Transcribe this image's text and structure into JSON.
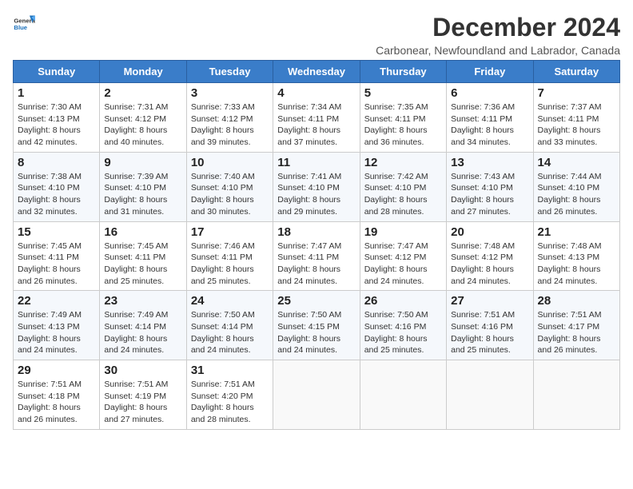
{
  "logo": {
    "line1": "General",
    "line2": "Blue"
  },
  "title": "December 2024",
  "subtitle": "Carbonear, Newfoundland and Labrador, Canada",
  "days_of_week": [
    "Sunday",
    "Monday",
    "Tuesday",
    "Wednesday",
    "Thursday",
    "Friday",
    "Saturday"
  ],
  "weeks": [
    [
      {
        "day": "1",
        "info": "Sunrise: 7:30 AM\nSunset: 4:13 PM\nDaylight: 8 hours\nand 42 minutes."
      },
      {
        "day": "2",
        "info": "Sunrise: 7:31 AM\nSunset: 4:12 PM\nDaylight: 8 hours\nand 40 minutes."
      },
      {
        "day": "3",
        "info": "Sunrise: 7:33 AM\nSunset: 4:12 PM\nDaylight: 8 hours\nand 39 minutes."
      },
      {
        "day": "4",
        "info": "Sunrise: 7:34 AM\nSunset: 4:11 PM\nDaylight: 8 hours\nand 37 minutes."
      },
      {
        "day": "5",
        "info": "Sunrise: 7:35 AM\nSunset: 4:11 PM\nDaylight: 8 hours\nand 36 minutes."
      },
      {
        "day": "6",
        "info": "Sunrise: 7:36 AM\nSunset: 4:11 PM\nDaylight: 8 hours\nand 34 minutes."
      },
      {
        "day": "7",
        "info": "Sunrise: 7:37 AM\nSunset: 4:11 PM\nDaylight: 8 hours\nand 33 minutes."
      }
    ],
    [
      {
        "day": "8",
        "info": "Sunrise: 7:38 AM\nSunset: 4:10 PM\nDaylight: 8 hours\nand 32 minutes."
      },
      {
        "day": "9",
        "info": "Sunrise: 7:39 AM\nSunset: 4:10 PM\nDaylight: 8 hours\nand 31 minutes."
      },
      {
        "day": "10",
        "info": "Sunrise: 7:40 AM\nSunset: 4:10 PM\nDaylight: 8 hours\nand 30 minutes."
      },
      {
        "day": "11",
        "info": "Sunrise: 7:41 AM\nSunset: 4:10 PM\nDaylight: 8 hours\nand 29 minutes."
      },
      {
        "day": "12",
        "info": "Sunrise: 7:42 AM\nSunset: 4:10 PM\nDaylight: 8 hours\nand 28 minutes."
      },
      {
        "day": "13",
        "info": "Sunrise: 7:43 AM\nSunset: 4:10 PM\nDaylight: 8 hours\nand 27 minutes."
      },
      {
        "day": "14",
        "info": "Sunrise: 7:44 AM\nSunset: 4:10 PM\nDaylight: 8 hours\nand 26 minutes."
      }
    ],
    [
      {
        "day": "15",
        "info": "Sunrise: 7:45 AM\nSunset: 4:11 PM\nDaylight: 8 hours\nand 26 minutes."
      },
      {
        "day": "16",
        "info": "Sunrise: 7:45 AM\nSunset: 4:11 PM\nDaylight: 8 hours\nand 25 minutes."
      },
      {
        "day": "17",
        "info": "Sunrise: 7:46 AM\nSunset: 4:11 PM\nDaylight: 8 hours\nand 25 minutes."
      },
      {
        "day": "18",
        "info": "Sunrise: 7:47 AM\nSunset: 4:11 PM\nDaylight: 8 hours\nand 24 minutes."
      },
      {
        "day": "19",
        "info": "Sunrise: 7:47 AM\nSunset: 4:12 PM\nDaylight: 8 hours\nand 24 minutes."
      },
      {
        "day": "20",
        "info": "Sunrise: 7:48 AM\nSunset: 4:12 PM\nDaylight: 8 hours\nand 24 minutes."
      },
      {
        "day": "21",
        "info": "Sunrise: 7:48 AM\nSunset: 4:13 PM\nDaylight: 8 hours\nand 24 minutes."
      }
    ],
    [
      {
        "day": "22",
        "info": "Sunrise: 7:49 AM\nSunset: 4:13 PM\nDaylight: 8 hours\nand 24 minutes."
      },
      {
        "day": "23",
        "info": "Sunrise: 7:49 AM\nSunset: 4:14 PM\nDaylight: 8 hours\nand 24 minutes."
      },
      {
        "day": "24",
        "info": "Sunrise: 7:50 AM\nSunset: 4:14 PM\nDaylight: 8 hours\nand 24 minutes."
      },
      {
        "day": "25",
        "info": "Sunrise: 7:50 AM\nSunset: 4:15 PM\nDaylight: 8 hours\nand 24 minutes."
      },
      {
        "day": "26",
        "info": "Sunrise: 7:50 AM\nSunset: 4:16 PM\nDaylight: 8 hours\nand 25 minutes."
      },
      {
        "day": "27",
        "info": "Sunrise: 7:51 AM\nSunset: 4:16 PM\nDaylight: 8 hours\nand 25 minutes."
      },
      {
        "day": "28",
        "info": "Sunrise: 7:51 AM\nSunset: 4:17 PM\nDaylight: 8 hours\nand 26 minutes."
      }
    ],
    [
      {
        "day": "29",
        "info": "Sunrise: 7:51 AM\nSunset: 4:18 PM\nDaylight: 8 hours\nand 26 minutes."
      },
      {
        "day": "30",
        "info": "Sunrise: 7:51 AM\nSunset: 4:19 PM\nDaylight: 8 hours\nand 27 minutes."
      },
      {
        "day": "31",
        "info": "Sunrise: 7:51 AM\nSunset: 4:20 PM\nDaylight: 8 hours\nand 28 minutes."
      },
      {
        "day": "",
        "info": ""
      },
      {
        "day": "",
        "info": ""
      },
      {
        "day": "",
        "info": ""
      },
      {
        "day": "",
        "info": ""
      }
    ]
  ]
}
